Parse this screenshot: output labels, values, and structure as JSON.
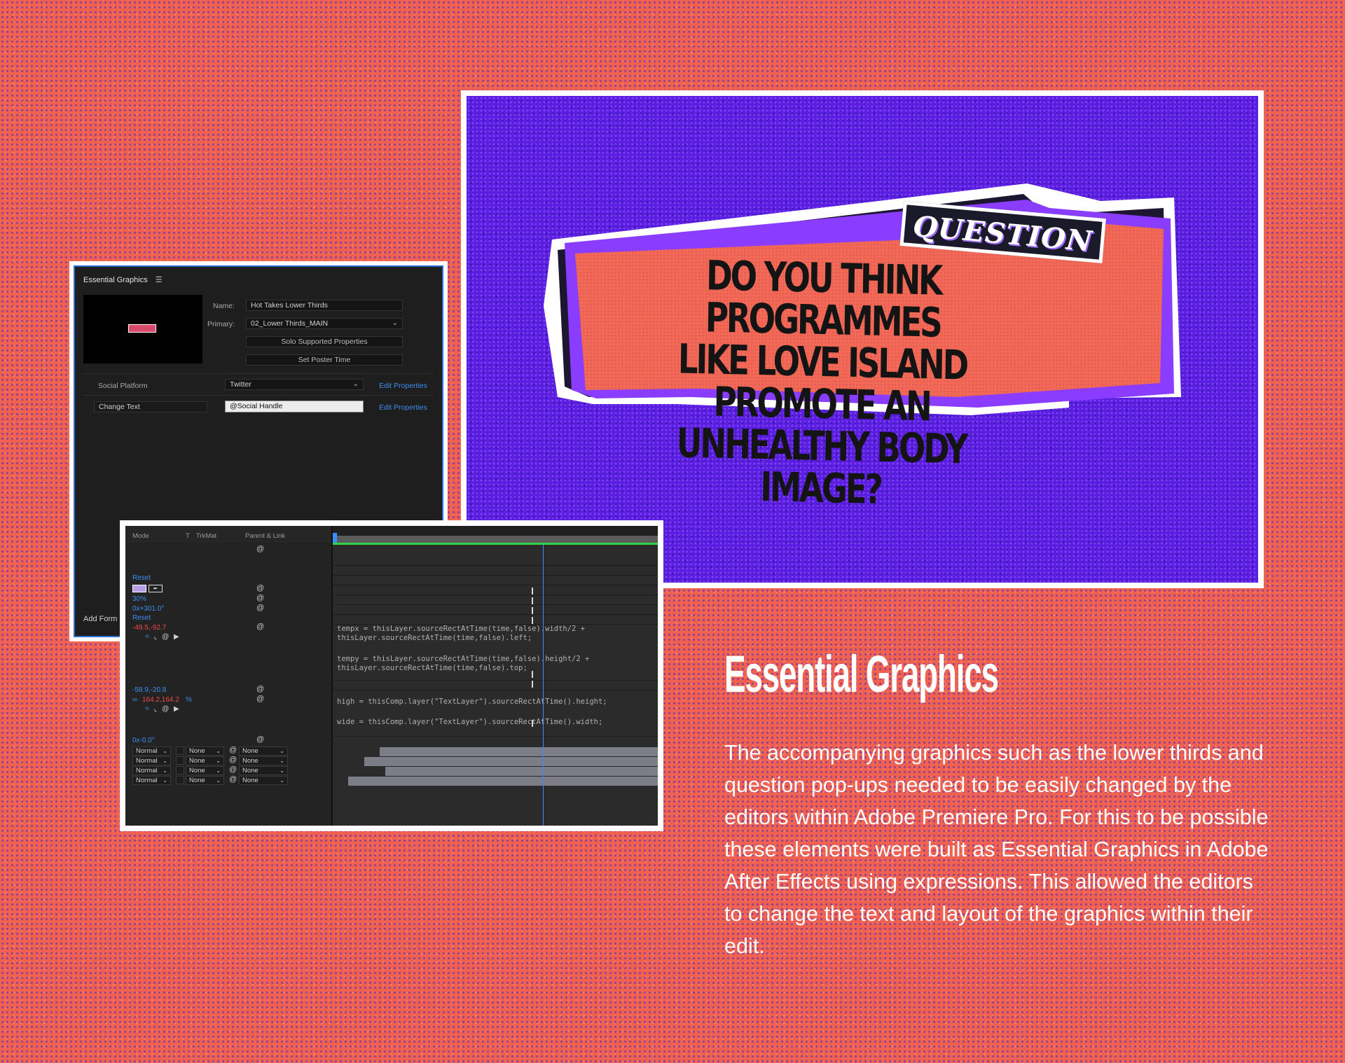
{
  "essential_graphics": {
    "title": "Essential Graphics",
    "menu_icon": "hamburger-icon",
    "name_label": "Name:",
    "name_value": "Hot Takes Lower Thirds",
    "primary_label": "Primary:",
    "primary_value": "02_Lower Thirds_MAIN",
    "solo_button": "Solo Supported Properties",
    "poster_button": "Set Poster Time",
    "properties": [
      {
        "label": "Social Platform",
        "value": "Twitter",
        "link": "Edit Properties"
      },
      {
        "label": "Change Text",
        "value": "@Social Handle",
        "link": "Edit Properties"
      }
    ],
    "add_form": "Add Form"
  },
  "timeline": {
    "headers": {
      "mode": "Mode",
      "t": "T",
      "trkmat": "TrkMat",
      "parent": "Parent & Link"
    },
    "values": {
      "reset1": "Reset",
      "opacity": "30%",
      "rotation": "0x+301.0°",
      "reset2": "Reset",
      "pos1": "-49.5,-92.7",
      "pos2": "-58.9,-20.8",
      "scale_a": "164.2,164.2",
      "scale_pct": "%",
      "rot2": "0x-0.0°"
    },
    "expressions": {
      "tempx_1": "tempx = thisLayer.sourceRectAtTime(time,false).width/2 +",
      "tempx_2": "thisLayer.sourceRectAtTime(time,false).left;",
      "tempy_1": "tempy = thisLayer.sourceRectAtTime(time,false).height/2 +",
      "tempy_2": "thisLayer.sourceRectAtTime(time,false).top;",
      "high": "high = thisComp.layer(\"TextLayer\").sourceRectAtTime().height;",
      "wide": "wide = thisComp.layer(\"TextLayer\").sourceRectAtTime().width;"
    },
    "layer_rows": [
      {
        "mode": "Normal",
        "trkmat": "None",
        "parent": "None"
      },
      {
        "mode": "Normal",
        "trkmat": "None",
        "parent": "None"
      },
      {
        "mode": "Normal",
        "trkmat": "None",
        "parent": "None"
      },
      {
        "mode": "Normal",
        "trkmat": "None",
        "parent": "None"
      }
    ],
    "colors": {
      "accent": "#3d8ff0",
      "keyed": "#f04a4a",
      "work_area": "#32d24a"
    }
  },
  "preview": {
    "tag": "QUESTION",
    "line1": "DO YOU THINK PROGRAMMES",
    "line2": "LIKE LOVE ISLAND PROMOTE AN",
    "line3": "UNHEALTHY BODY IMAGE?"
  },
  "article": {
    "heading": "Essential Graphics",
    "body": "The accompanying graphics such as the lower thirds and question pop-ups needed to be easily changed by the editors within Adobe Premiere Pro. For this to be possible these elements were built as Essential Graphics in Adobe After Effects using expressions. This allowed the editors to change the text and layout of the graphics within their edit."
  },
  "palette": {
    "background": "#f0614f",
    "preview_bg": "#5a1ee0",
    "card": "#f26a55"
  }
}
